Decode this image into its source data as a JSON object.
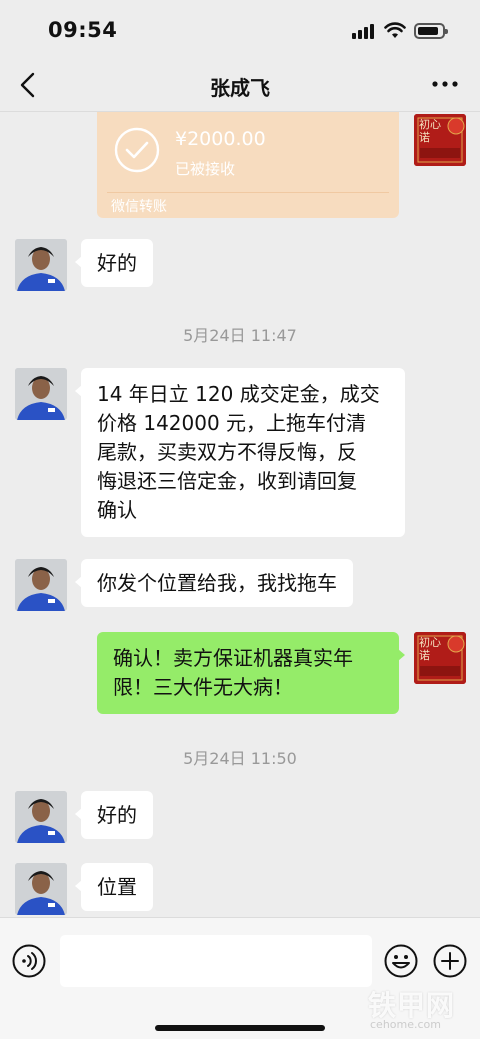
{
  "status_bar": {
    "time": "09:54"
  },
  "header": {
    "title": "张成飞"
  },
  "transfer": {
    "amount": "¥2000.00",
    "status": "已被接收",
    "type": "微信转账"
  },
  "messages": [
    {
      "side": "left",
      "text": "好的"
    },
    {
      "side": "time",
      "text": "5月24日 11:47"
    },
    {
      "side": "left",
      "lines": [
        "14 年日立 120 成交定金，成交",
        "价格 142000 元，上拖车付清",
        "尾款，买卖双方不得反悔，反",
        "悔退还三倍定金，收到请回复",
        "确认"
      ]
    },
    {
      "side": "left",
      "text": "你发个位置给我，我找拖车"
    },
    {
      "side": "right",
      "lines": [
        "确认！卖方保证机器真实年",
        "限！三大件无大病！"
      ]
    },
    {
      "side": "time",
      "text": "5月24日 11:50"
    },
    {
      "side": "left",
      "text": "好的"
    },
    {
      "side": "left",
      "text": "位置"
    }
  ],
  "self_avatar_text": "初心诺",
  "watermark": {
    "main": "铁甲网",
    "sub": "cehome.com"
  },
  "colors": {
    "background": "#ededed",
    "bubble_self": "#95ec69",
    "bubble_other": "#ffffff",
    "transfer_card": "#f7dcbf"
  }
}
